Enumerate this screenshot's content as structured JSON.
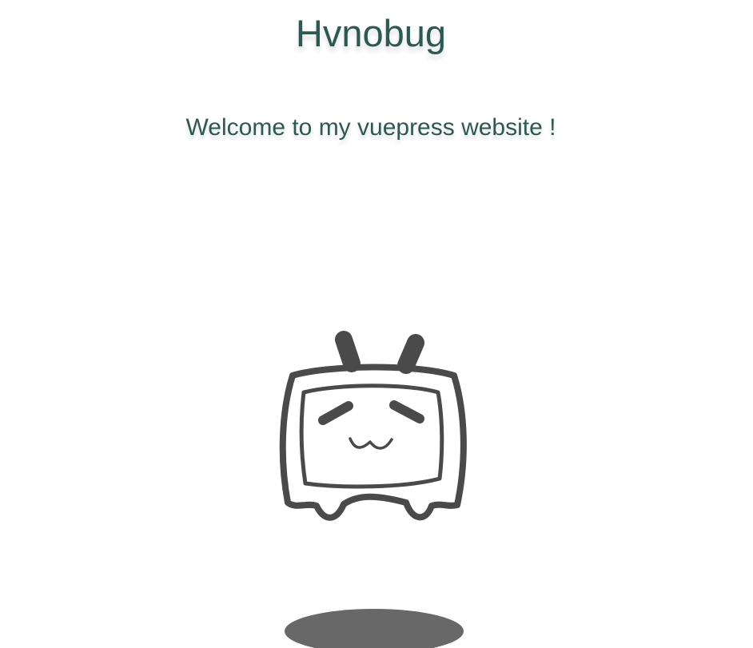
{
  "hero": {
    "title": "Hvnobug",
    "subtitle": "Welcome to my vuepress website !"
  },
  "mascot": {
    "icon": "tv-mascot-icon",
    "stroke_color": "#4a4a4a",
    "shadow_color": "#686868"
  },
  "colors": {
    "text_accent": "#2c5a50",
    "background": "#ffffff"
  }
}
